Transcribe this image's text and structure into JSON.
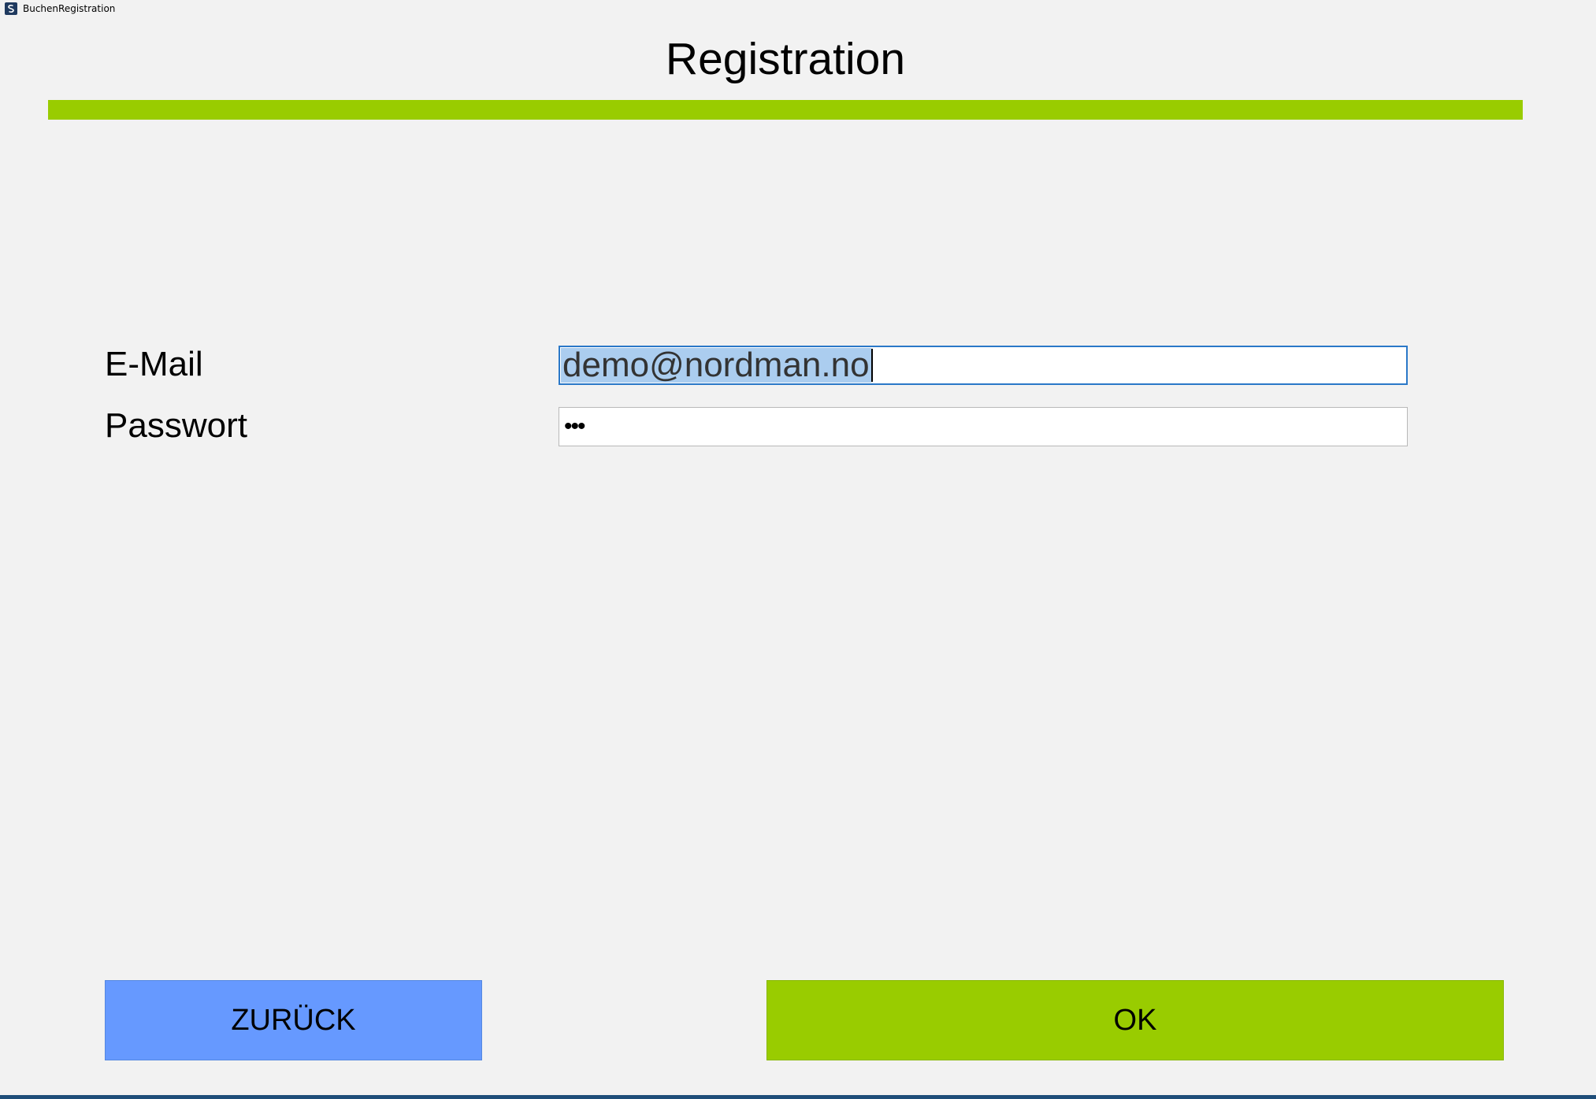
{
  "window": {
    "title": "BuchenRegistration",
    "icon": "app-icon"
  },
  "header": {
    "title": "Registration"
  },
  "form": {
    "email_label": "E-Mail",
    "email_value": "demo@nordman.no",
    "password_label": "Passwort",
    "password_value_masked": "•••"
  },
  "buttons": {
    "back_label": "ZURÜCK",
    "ok_label": "OK"
  },
  "colors": {
    "accent_green": "#99cc00",
    "back_blue": "#6699ff",
    "selection": "#abcdef",
    "focus_border": "#2a78c8",
    "background": "#f2f2f2"
  }
}
